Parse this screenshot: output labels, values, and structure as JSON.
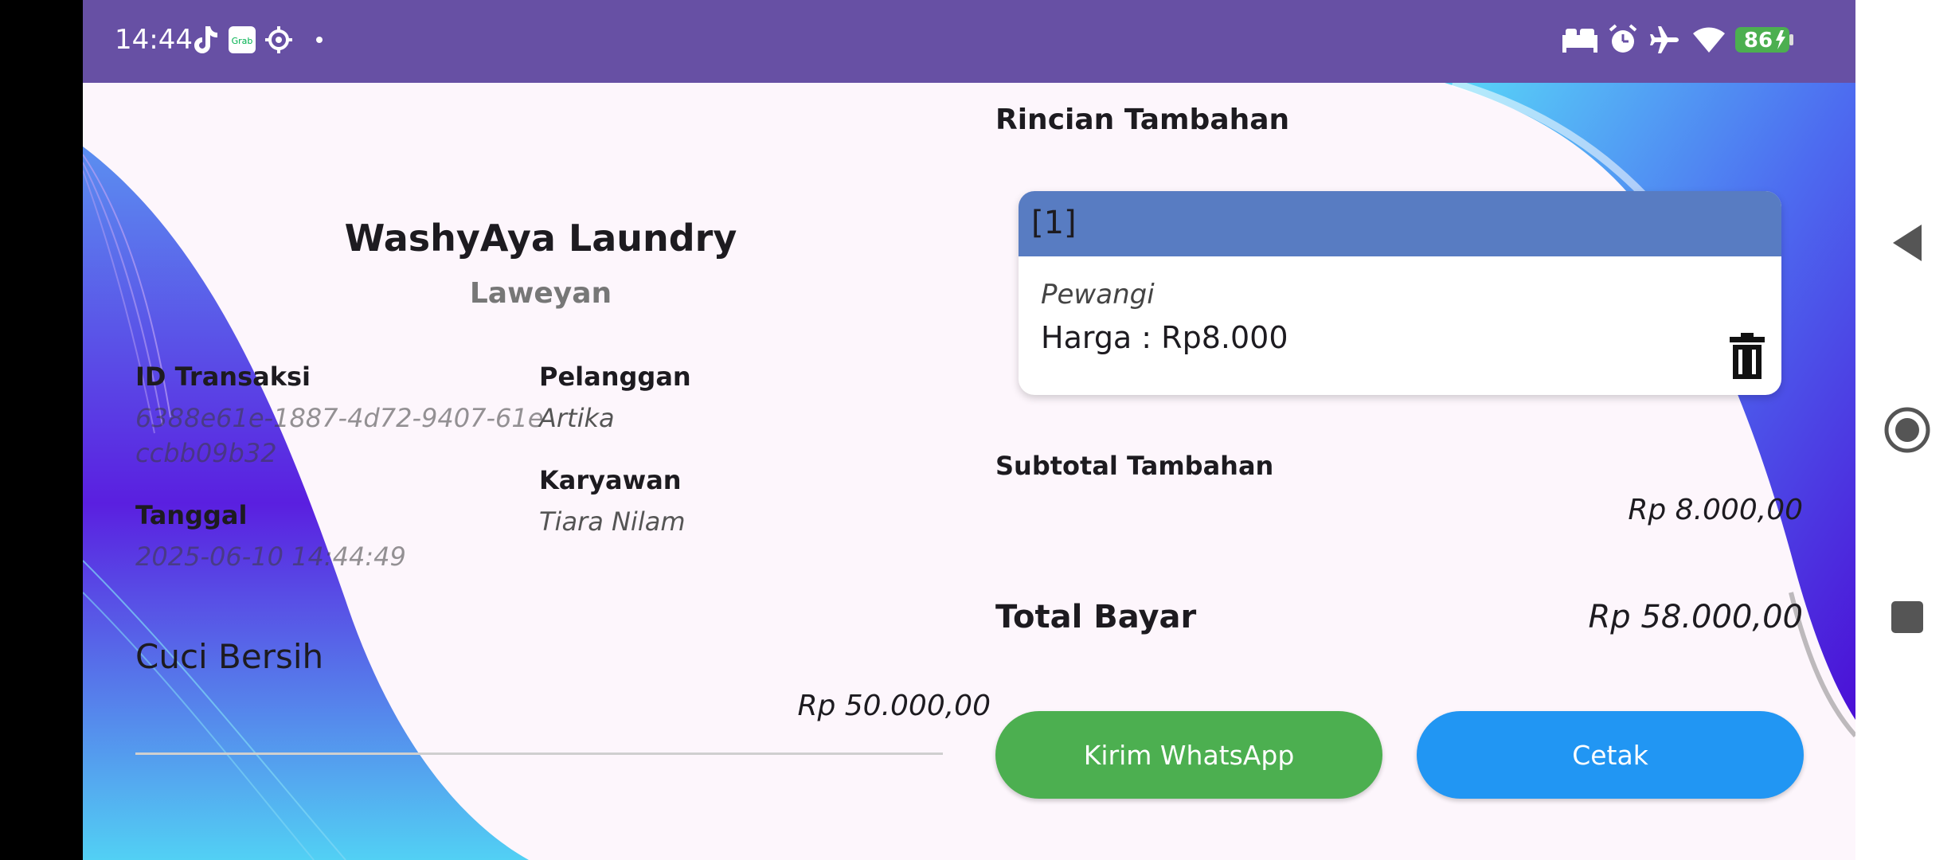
{
  "status_bar": {
    "time": "14:44",
    "battery": "86",
    "left_icons": [
      "tiktok-icon",
      "grab-icon",
      "settings-icon",
      "dot-icon"
    ],
    "right_icons": [
      "bed-icon",
      "alarm-icon",
      "airplane-icon",
      "wifi-icon",
      "battery-icon"
    ]
  },
  "receipt": {
    "shop_name": "WashyAya Laundry",
    "branch": "Laweyan",
    "id_label": "ID Transaksi",
    "id_line1": "6388e61e-1887-4d72-9407-61e",
    "id_line2": "ccbb09b32",
    "customer_label": "Pelanggan",
    "customer": "Artika",
    "employee_label": "Karyawan",
    "employee": "Tiara Nilam",
    "date_label": "Tanggal",
    "date": "2025-06-10 14:44:49",
    "service": "Cuci Bersih",
    "service_price": "Rp 50.000,00"
  },
  "extras": {
    "title": "Rincian Tambahan",
    "items": [
      {
        "index": "[1]",
        "name": "Pewangi",
        "price": "Harga : Rp8.000"
      }
    ],
    "subtotal_label": "Subtotal Tambahan",
    "subtotal": "Rp 8.000,00"
  },
  "total": {
    "label": "Total Bayar",
    "value": "Rp 58.000,00"
  },
  "buttons": {
    "whatsapp": "Kirim WhatsApp",
    "print": "Cetak"
  },
  "colors": {
    "status_bar": "#6750a4",
    "card_header": "#587cc2",
    "whatsapp_button": "#4caf50",
    "print_button": "#2196f3",
    "background": "#fdf6fc"
  },
  "nav_icons": [
    "back-icon",
    "home-icon",
    "recents-icon"
  ]
}
